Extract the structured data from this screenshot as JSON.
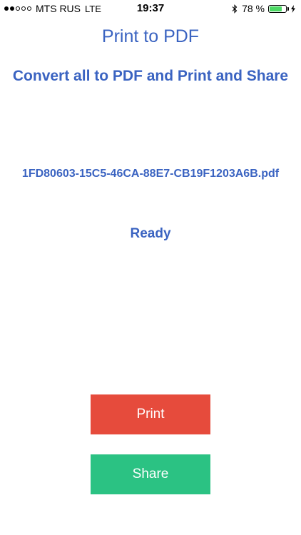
{
  "status_bar": {
    "signal_filled": 2,
    "signal_total": 5,
    "carrier": "MTS RUS",
    "network": "LTE",
    "time": "19:37",
    "battery_percent": "78 %",
    "battery_level": 0.78,
    "battery_color": "#4cd964",
    "icons": [
      "bluetooth-icon",
      "battery-icon",
      "charging-bolt-icon"
    ]
  },
  "app": {
    "title": "Print to PDF",
    "subtitle": "Convert all to PDF and Print and Share",
    "filename": "1FD80603-15C5-46CA-88E7-CB19F1203A6B.pdf",
    "status": "Ready"
  },
  "buttons": {
    "print_label": "Print",
    "share_label": "Share"
  },
  "colors": {
    "text_accent": "#3a63c1",
    "print_button": "#e64b3c",
    "share_button": "#2bc283"
  }
}
